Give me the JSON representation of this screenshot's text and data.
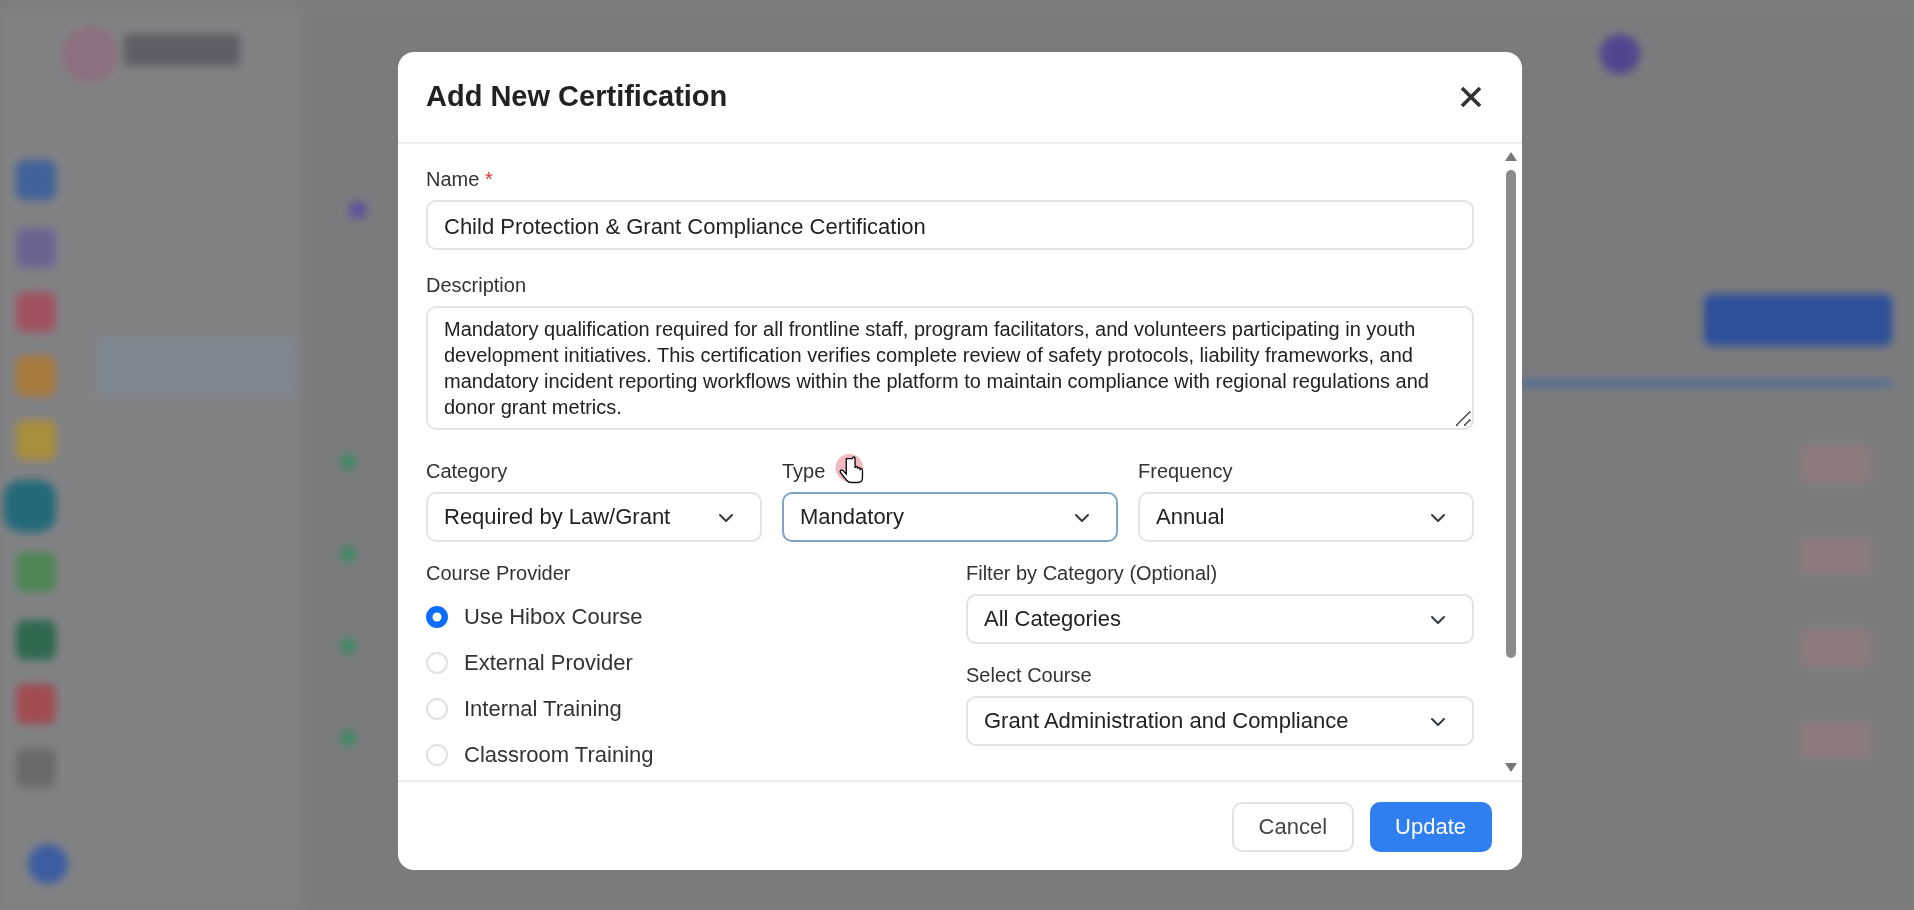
{
  "dialog": {
    "title": "Add New Certification",
    "name_field": {
      "label": "Name",
      "required_mark": "*",
      "value": "Child Protection & Grant Compliance Certification"
    },
    "description_field": {
      "label": "Description",
      "value": "Mandatory qualification required for all frontline staff, program facilitators, and volunteers participating in youth development initiatives. This certification verifies complete review of safety protocols, liability frameworks, and mandatory incident reporting workflows within the platform to maintain compliance with regional regulations and donor grant metrics."
    },
    "selects": [
      {
        "label": "Category",
        "value": "Required by Law/Grant",
        "focused": false
      },
      {
        "label": "Type",
        "value": "Mandatory",
        "focused": true
      },
      {
        "label": "Frequency",
        "value": "Annual",
        "focused": false
      }
    ],
    "course_provider": {
      "label": "Course Provider",
      "options": [
        {
          "label": "Use Hibox Course",
          "selected": true
        },
        {
          "label": "External Provider",
          "selected": false
        },
        {
          "label": "Internal Training",
          "selected": false
        },
        {
          "label": "Classroom Training",
          "selected": false
        }
      ]
    },
    "filter_field": {
      "label": "Filter by Category (Optional)",
      "value": "All Categories"
    },
    "course_field": {
      "label": "Select Course",
      "value": "Grant Administration and Compliance"
    },
    "buttons": [
      {
        "label": "Cancel",
        "kind": "secondary"
      },
      {
        "label": "Update",
        "kind": "primary"
      }
    ]
  }
}
